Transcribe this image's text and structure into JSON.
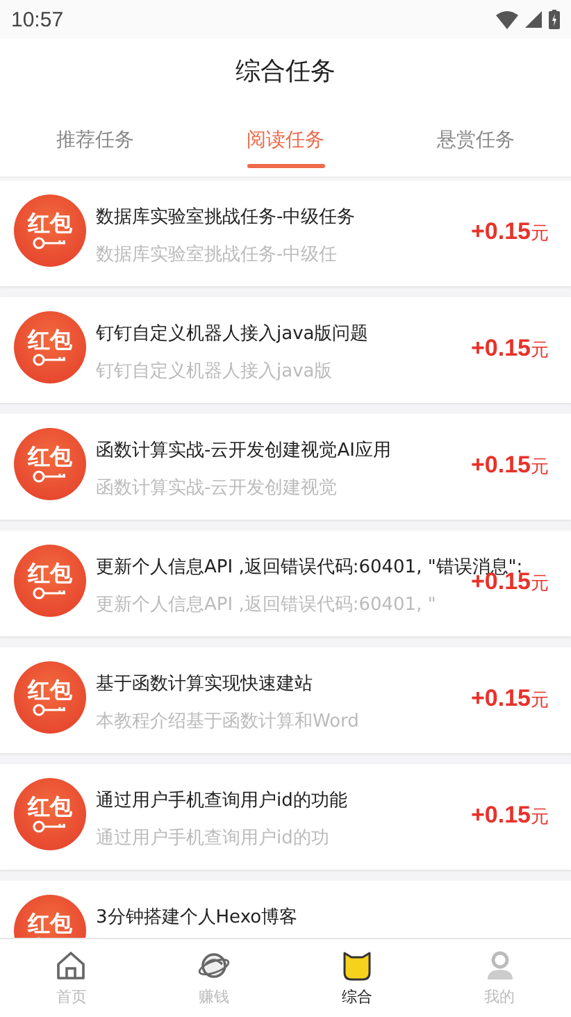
{
  "status_bar": {
    "time": "10:57"
  },
  "header": {
    "title": "综合任务"
  },
  "tabs": [
    {
      "label": "推荐任务",
      "selected": false
    },
    {
      "label": "阅读任务",
      "selected": true
    },
    {
      "label": "悬赏任务",
      "selected": false
    }
  ],
  "tasks": [
    {
      "badge": "红包",
      "title": "数据库实验室挑战任务-中级任务",
      "subtitle": "数据库实验室挑战任务-中级任",
      "amount": "+0.15",
      "unit": "元"
    },
    {
      "badge": "红包",
      "title": "钉钉自定义机器人接入java版问题",
      "subtitle": "钉钉自定义机器人接入java版",
      "amount": "+0.15",
      "unit": "元"
    },
    {
      "badge": "红包",
      "title": "函数计算实战-云开发创建视觉AI应用",
      "subtitle": "函数计算实战-云开发创建视觉",
      "amount": "+0.15",
      "unit": "元"
    },
    {
      "badge": "红包",
      "title": "更新个人信息API ,返回错误代码:60401, \"错误消息\":",
      "subtitle": "更新个人信息API ,返回错误代码:60401, \"",
      "amount": "+0.15",
      "unit": "元"
    },
    {
      "badge": "红包",
      "title": "基于函数计算实现快速建站",
      "subtitle": "本教程介绍基于函数计算和Word",
      "amount": "+0.15",
      "unit": "元"
    },
    {
      "badge": "红包",
      "title": "通过用户手机查询用户id的功能",
      "subtitle": "通过用户手机查询用户id的功",
      "amount": "+0.15",
      "unit": "元"
    },
    {
      "badge": "红包",
      "title": "3分钟搭建个人Hexo博客"
    }
  ],
  "bottom_nav": [
    {
      "kind": "home",
      "label": "首页",
      "selected": false
    },
    {
      "kind": "planet",
      "label": "赚钱",
      "selected": false
    },
    {
      "kind": "cat",
      "label": "综合",
      "selected": true
    },
    {
      "kind": "person",
      "label": "我的",
      "selected": false
    }
  ]
}
